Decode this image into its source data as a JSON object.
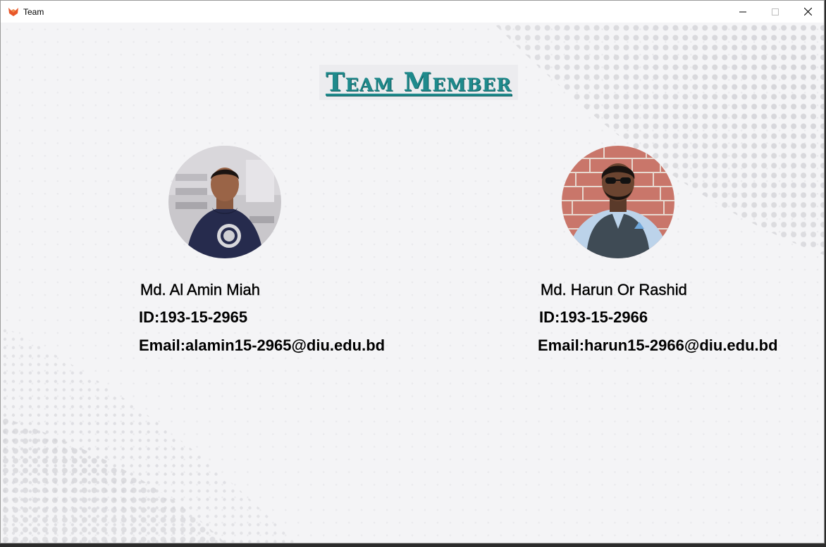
{
  "window": {
    "title": "Team",
    "controls": [
      "minimize-icon",
      "maximize-icon",
      "close-icon"
    ]
  },
  "page": {
    "heading": "Team Member"
  },
  "members": [
    {
      "name": "Md. Al Amin Miah",
      "id": "ID:193-15-2965",
      "email": "Email:alamin15-2965@diu.edu.bd",
      "photo": "avatar-photo-hoodie"
    },
    {
      "name": "Md. Harun Or Rashid",
      "id": "ID:193-15-2966",
      "email": "Email:harun15-2966@diu.edu.bd",
      "photo": "avatar-photo-brick-wall"
    }
  ],
  "colors": {
    "heading": "#1f8a8c",
    "background": "#f4f4f6",
    "app_icon": "#e8572a"
  }
}
